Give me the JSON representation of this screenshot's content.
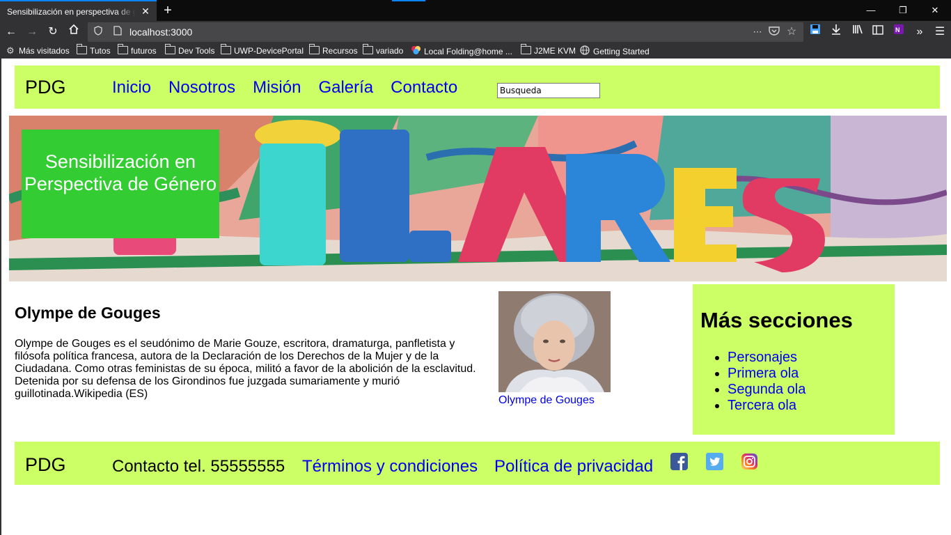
{
  "browser": {
    "tab_title": "Sensibilización en perspectiva de género",
    "tab_close": "✕",
    "new_tab": "+",
    "url": "localhost:3000",
    "bookmarks": [
      {
        "label": "Más visitados",
        "icon": "gear-icon"
      },
      {
        "label": "Tutos",
        "icon": "folder-icon"
      },
      {
        "label": "futuros",
        "icon": "folder-icon"
      },
      {
        "label": "Dev Tools",
        "icon": "folder-icon"
      },
      {
        "label": "UWP-DevicePortal",
        "icon": "folder-icon"
      },
      {
        "label": "Recursos",
        "icon": "folder-icon"
      },
      {
        "label": "variado",
        "icon": "folder-icon"
      },
      {
        "label": "Local Folding@home ...",
        "icon": "folding-icon"
      },
      {
        "label": "J2ME KVM",
        "icon": "folder-icon"
      },
      {
        "label": "Getting Started",
        "icon": "globe-icon"
      }
    ]
  },
  "header": {
    "brand": "PDG",
    "nav": [
      "Inicio",
      "Nosotros",
      "Misión",
      "Galería",
      "Contacto"
    ],
    "search_value": "Busqueda"
  },
  "hero": {
    "title": "Sensibilización en Perspectiva de Género"
  },
  "article": {
    "heading": "Olympe de Gouges",
    "body": "Olympe de Gouges es el seudónimo de Marie Gouze, escritora, dramaturga, panfletista y filósofa política francesa, autora de la Declaración de los Derechos de la Mujer y de la Ciudadana. Como otras feministas de su época, militó a favor de la abolición de la esclavitud. Detenida por su defensa de los Girondinos fue juzgada sumariamente y murió guillotinada.Wikipedia (ES)",
    "image_caption": "Olympe de Gouges"
  },
  "aside": {
    "heading": "Más secciones",
    "items": [
      "Personajes",
      "Primera ola",
      "Segunda ola",
      "Tercera ola"
    ]
  },
  "footer": {
    "brand": "PDG",
    "contact": "Contacto tel. 55555555",
    "terms": "Términos y condiciones",
    "privacy": "Política de privacidad",
    "social_icons": [
      "facebook-icon",
      "twitter-icon",
      "instagram-icon"
    ]
  },
  "colors": {
    "header_bg": "#ccff66",
    "hero_box_bg": "#33cc33",
    "link": "#0000ee",
    "chrome_dark": "#0c0c0d",
    "chrome_toolbar": "#323234"
  }
}
